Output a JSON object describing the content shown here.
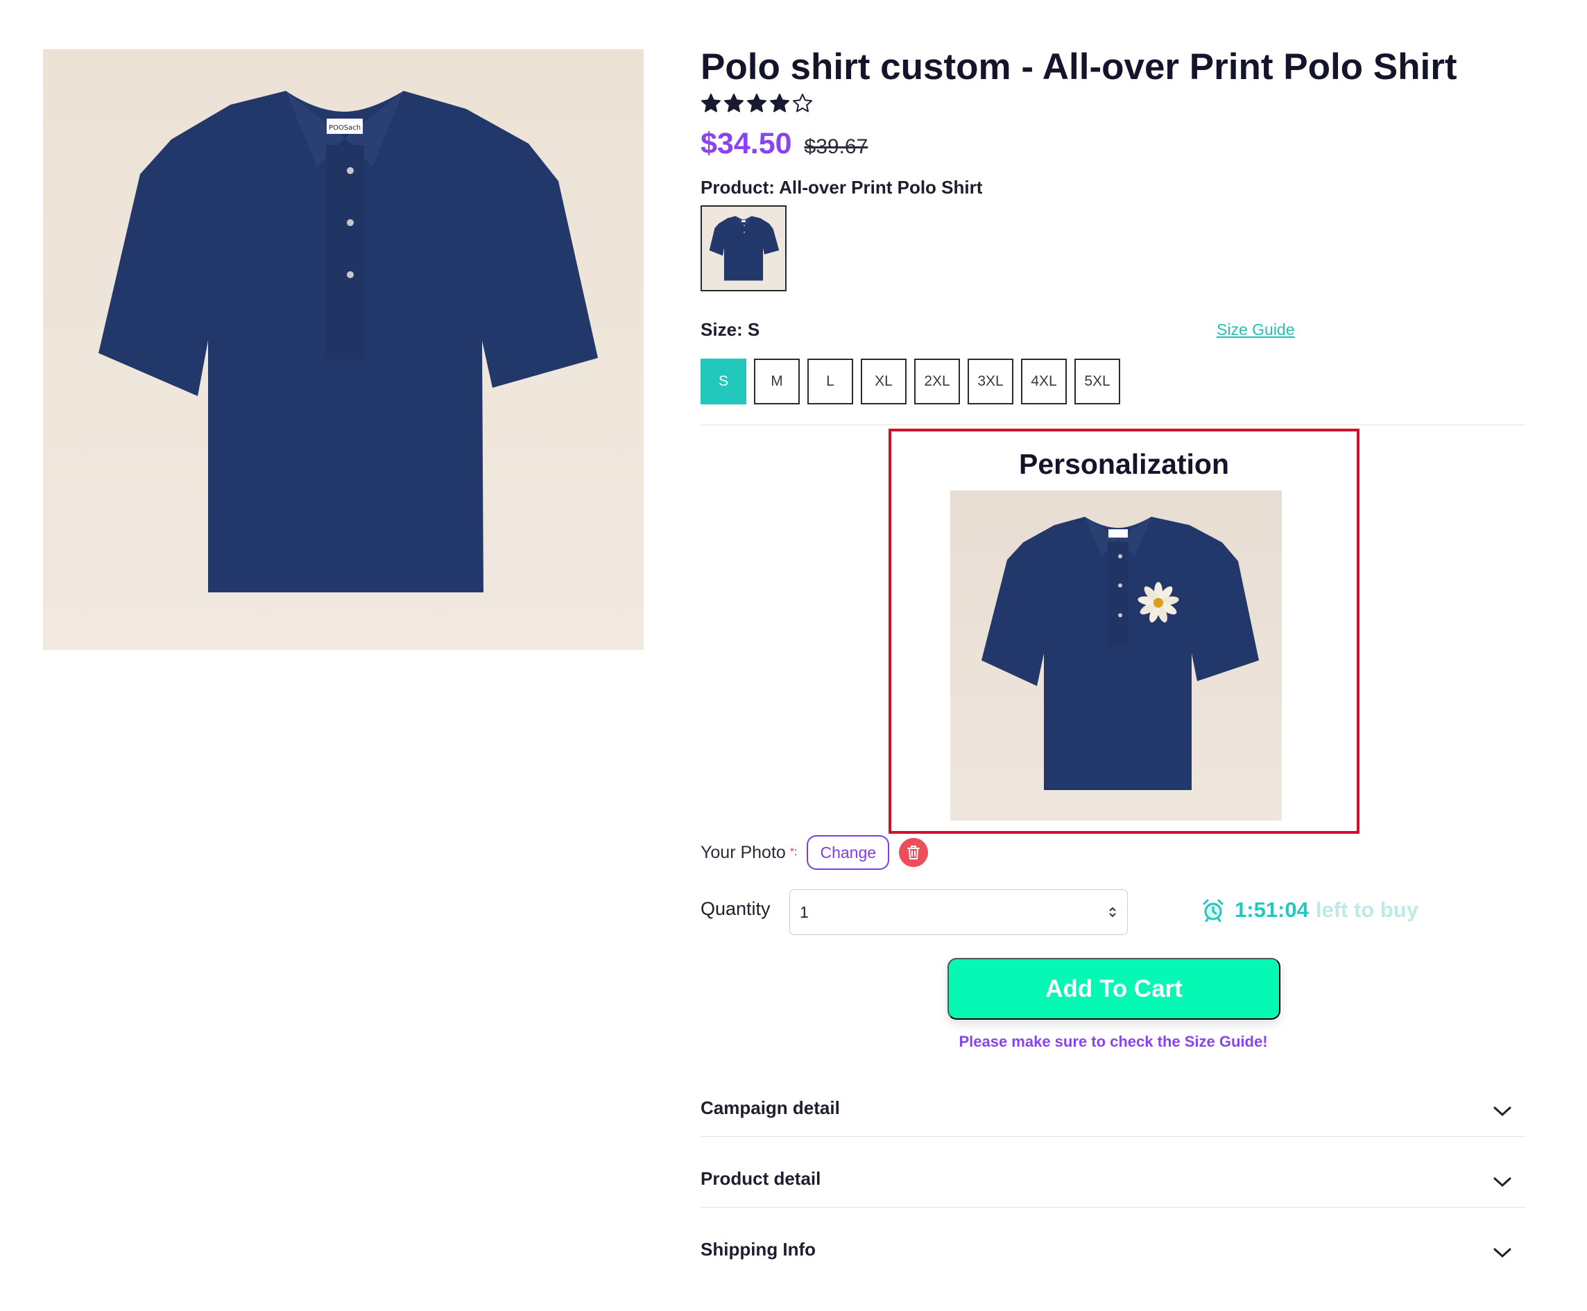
{
  "product": {
    "title": "Polo shirt custom - All-over Print Polo Shirt",
    "rating": 4,
    "rating_max": 5,
    "price": "$34.50",
    "old_price": "$39.67",
    "product_label": "Product: All-over Print Polo Shirt",
    "shirt_color": "#23386a",
    "tag_text": "POOSach"
  },
  "size": {
    "label": "Size: S",
    "guide_link": "Size Guide",
    "options": [
      "S",
      "M",
      "L",
      "XL",
      "2XL",
      "3XL",
      "4XL",
      "5XL"
    ],
    "selected": "S",
    "accent_color": "#22c8bb"
  },
  "personalization": {
    "title": "Personalization",
    "photo_label": "Your Photo",
    "required_mark": "*",
    "colon": ":",
    "change_label": "Change"
  },
  "quantity": {
    "label": "Quantity",
    "value": "1"
  },
  "timer": {
    "time": "1:51:04",
    "text": "left to buy",
    "icon": "alarm-clock-icon"
  },
  "cart": {
    "add_label": "Add To Cart",
    "note": "Please make sure to check the Size Guide!",
    "button_color": "#05f9b4",
    "note_color": "#8a43f0"
  },
  "accordions": [
    {
      "title": "Campaign detail"
    },
    {
      "title": "Product detail"
    },
    {
      "title": "Shipping Info"
    }
  ]
}
